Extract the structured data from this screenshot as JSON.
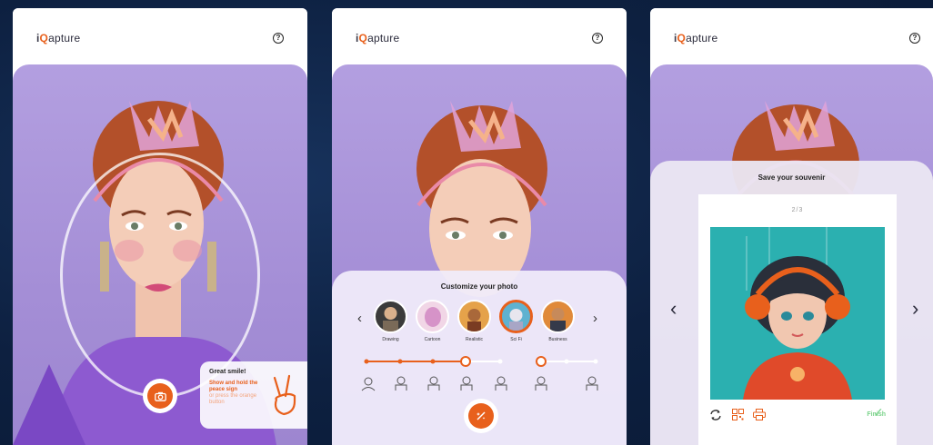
{
  "brand": {
    "logo_i": "i",
    "logo_q": "Q",
    "logo_rest": "apture"
  },
  "help_icon_label": "?",
  "screen1": {
    "hint": {
      "title": "Great smile!",
      "line_bold": "Show and hold the peace sign",
      "line_light": "or press the orange button"
    },
    "shutter_icon": "camera-icon"
  },
  "screen2": {
    "title": "Customize your photo",
    "styles": [
      {
        "label": "Drawing",
        "selected": false
      },
      {
        "label": "Cartoon",
        "selected": false
      },
      {
        "label": "Realistic",
        "selected": false
      },
      {
        "label": "Sci Fi",
        "selected": true
      },
      {
        "label": "Business",
        "selected": false
      }
    ],
    "prev_arrow": "‹",
    "next_arrow": "›",
    "action_icon": "magic-wand-icon"
  },
  "screen3": {
    "title": "Save your souvenir",
    "counter": "2/3",
    "prev_arrow": "‹",
    "next_arrow": "›",
    "finish_label": "Finish",
    "finish_check": "✓"
  },
  "colors": {
    "accent": "#e8601c",
    "background": "#0d2040",
    "photo_bg": "#a48ed6",
    "finish_green": "#7bd38b"
  }
}
